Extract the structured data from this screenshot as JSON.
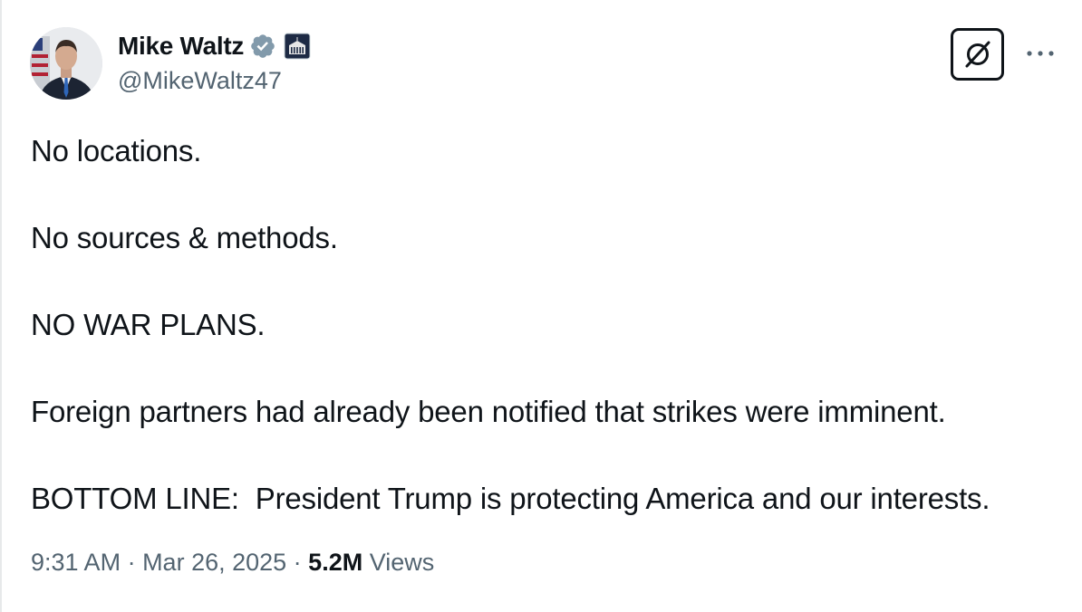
{
  "author": {
    "display_name": "Mike Waltz",
    "handle": "@MikeWaltz47",
    "verified_badge": "verified-badge-icon",
    "affiliation_badge": "white-house-icon"
  },
  "tweet": {
    "paragraphs": [
      "No locations.",
      "No sources & methods.",
      "NO WAR PLANS.",
      "Foreign partners had already been notified that strikes were imminent.",
      "BOTTOM LINE:  President Trump is protecting America and our interests."
    ]
  },
  "meta": {
    "time": "9:31 AM",
    "separator": " · ",
    "date": "Mar 26, 2025",
    "views_count": "5.2M",
    "views_label": " Views"
  },
  "toolbar": {
    "grok_icon": "grok-icon",
    "more_icon": "more-icon"
  },
  "colors": {
    "text_primary": "#0f1419",
    "text_secondary": "#536471",
    "verified": "#829aab"
  }
}
